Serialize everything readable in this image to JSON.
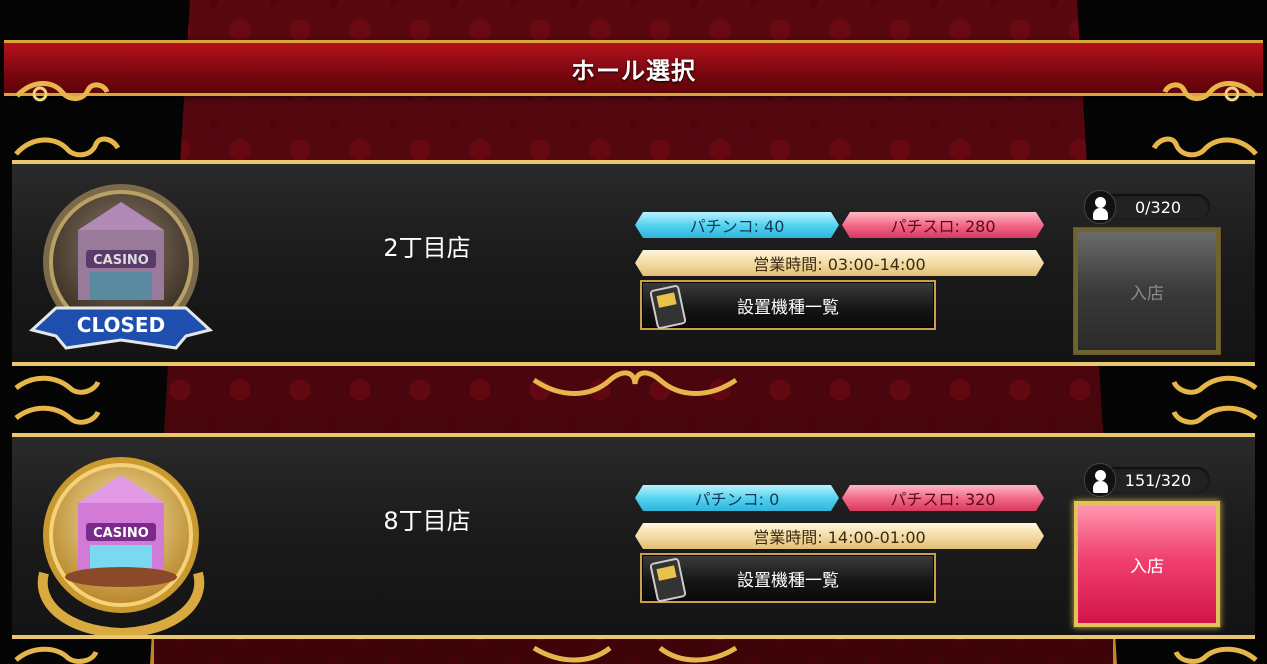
{
  "header": {
    "title": "ホール選択"
  },
  "halls": [
    {
      "name": "2丁目店",
      "status_ribbon": "CLOSED",
      "sign": "CASINO",
      "pachinko": "パチンコ: 40",
      "pachislo": "パチスロ: 280",
      "hours": "営業時間: 03:00-14:00",
      "machine_list_label": "設置機種一覧",
      "visitors": "0/320",
      "enter_label": "入店",
      "enter_enabled": false
    },
    {
      "name": "8丁目店",
      "sign": "CASINO",
      "pachinko": "パチンコ: 0",
      "pachislo": "パチスロ: 320",
      "hours": "営業時間: 14:00-01:00",
      "machine_list_label": "設置機種一覧",
      "visitors": "151/320",
      "enter_label": "入店",
      "enter_enabled": true
    }
  ],
  "colors": {
    "title_bar": "#9a0c16",
    "gold": "#e9c76c",
    "pachinko_pill": "#4fd0ee",
    "pachislo_pill": "#f06483",
    "hours_pill": "#f1d9a0",
    "enter_active": "#f0416f",
    "enter_disabled": "#3a3a3a"
  },
  "icons": [
    "casino-medal-icon",
    "slot-machine-icon",
    "person-icon",
    "gold-scroll-ornament"
  ]
}
